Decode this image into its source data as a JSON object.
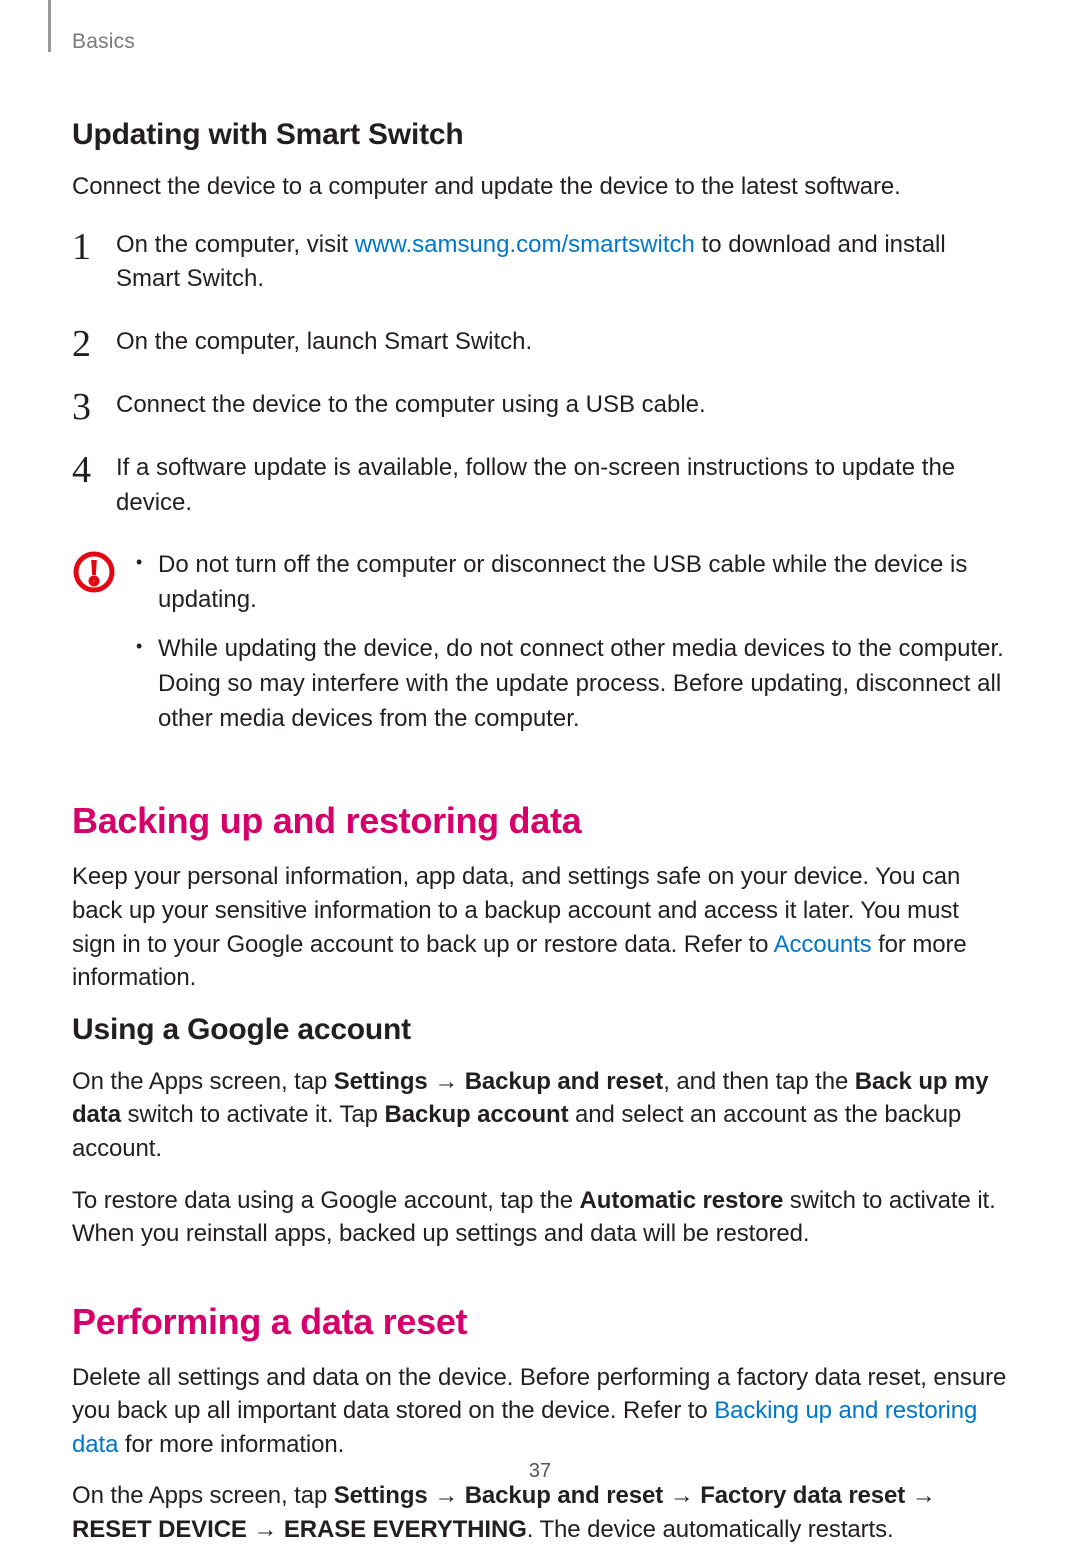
{
  "header": {
    "section": "Basics"
  },
  "sec1": {
    "heading": "Updating with Smart Switch",
    "intro": "Connect the device to a computer and update the device to the latest software.",
    "steps": {
      "n1": "1",
      "s1a": "On the computer, visit ",
      "s1link": "www.samsung.com/smartswitch",
      "s1b": " to download and install Smart Switch.",
      "n2": "2",
      "s2": "On the computer, launch Smart Switch.",
      "n3": "3",
      "s3": "Connect the device to the computer using a USB cable.",
      "n4": "4",
      "s4": "If a software update is available, follow the on-screen instructions to update the device."
    },
    "caution": {
      "b1": "Do not turn off the computer or disconnect the USB cable while the device is updating.",
      "b2": "While updating the device, do not connect other media devices to the computer. Doing so may interfere with the update process. Before updating, disconnect all other media devices from the computer."
    }
  },
  "sec2": {
    "heading": "Backing up and restoring data",
    "p1a": "Keep your personal information, app data, and settings safe on your device. You can back up your sensitive information to a backup account and access it later. You must sign in to your Google account to back up or restore data. Refer to ",
    "p1link": "Accounts",
    "p1b": " for more information.",
    "sub": "Using a Google account",
    "p2a": "On the Apps screen, tap ",
    "p2b_settings": "Settings",
    "arrow": " → ",
    "p2b_backupreset": "Backup and reset",
    "p2c": ", and then tap the ",
    "p2b_backupmydata": "Back up my data",
    "p2d": " switch to activate it. Tap ",
    "p2b_backupaccount": "Backup account",
    "p2e": " and select an account as the backup account.",
    "p3a": "To restore data using a Google account, tap the ",
    "p3b_autorestore": "Automatic restore",
    "p3b": " switch to activate it. When you reinstall apps, backed up settings and data will be restored."
  },
  "sec3": {
    "heading": "Performing a data reset",
    "p1a": "Delete all settings and data on the device. Before performing a factory data reset, ensure you back up all important data stored on the device. Refer to ",
    "p1link": "Backing up and restoring data",
    "p1b": " for more information.",
    "p2a": "On the Apps screen, tap ",
    "p2b_settings": "Settings",
    "p2b_backupreset": "Backup and reset",
    "p2b_fdr": "Factory data reset",
    "p2b_reset": "RESET DEVICE",
    "p2b_erase": "ERASE EVERYTHING",
    "p2c": ". The device automatically restarts."
  },
  "page": "37"
}
